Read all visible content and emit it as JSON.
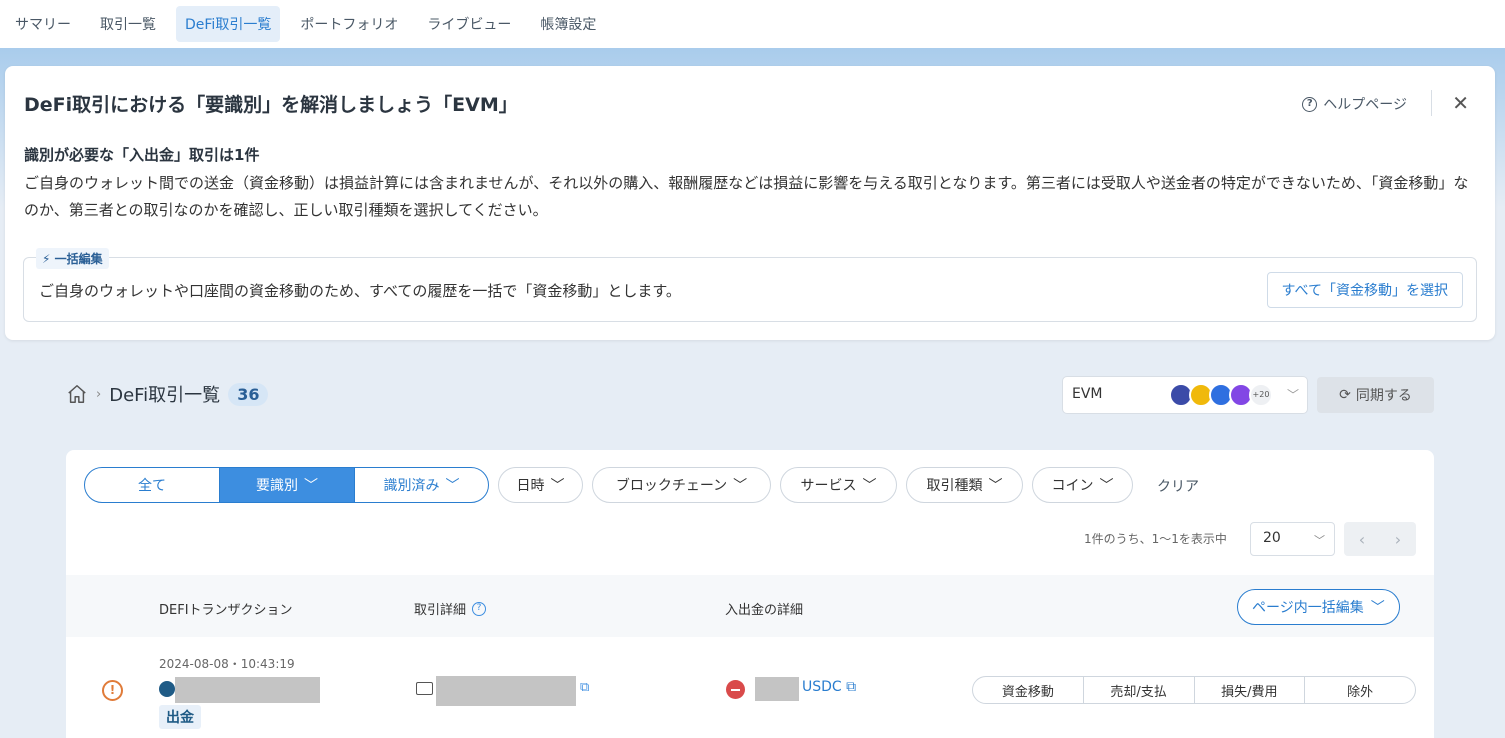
{
  "nav": {
    "tabs": [
      {
        "label": "サマリー"
      },
      {
        "label": "取引一覧"
      },
      {
        "label": "DeFi取引一覧",
        "active": true
      },
      {
        "label": "ポートフォリオ"
      },
      {
        "label": "ライブビュー"
      },
      {
        "label": "帳簿設定"
      }
    ]
  },
  "banner": {
    "title": "DeFi取引における「要識別」を解消しましょう「EVM」",
    "help_label": "ヘルプページ",
    "subtitle": "識別が必要な「入出金」取引は1件",
    "description": "ご自身のウォレット間での送金（資金移動）は損益計算には含まれませんが、それ以外の購入、報酬履歴などは損益に影響を与える取引となります。第三者には受取人や送金者の特定ができないため、「資金移動」なのか、第三者との取引なのかを確認し、正しい取引種類を選択してください。",
    "bulk_tag": "一括編集",
    "bulk_text": "ご自身のウォレットや口座間の資金移動のため、すべての履歴を一括で「資金移動」とします。",
    "bulk_button": "すべて「資金移動」を選択"
  },
  "breadcrumb": {
    "title": "DeFi取引一覧",
    "count": "36"
  },
  "chain_select": {
    "label": "EVM",
    "more": "+20"
  },
  "sync_button": "同期する",
  "filters": {
    "segments": [
      {
        "label": "全て"
      },
      {
        "label": "要識別",
        "active": true
      },
      {
        "label": "識別済み"
      }
    ],
    "dropdowns": [
      "日時",
      "ブロックチェーン",
      "サービス",
      "取引種類",
      "コイン"
    ],
    "clear": "クリア"
  },
  "pagination": {
    "info": "1件のうち、1〜1を表示中",
    "per_page": "20"
  },
  "table": {
    "headers": {
      "tx": "DEFIトランザクション",
      "detail": "取引詳細",
      "io": "入出金の詳細"
    },
    "bulk_page_button": "ページ内一括編集",
    "rows": [
      {
        "timestamp": "2024-08-08・10:43:19",
        "direction": "出金",
        "coin": "USDC",
        "type_options": [
          "資金移動",
          "売却/支払",
          "損失/費用",
          "除外"
        ]
      }
    ]
  },
  "colors": {
    "accent": "#2a7dcf",
    "warning": "#e07b39",
    "outflow": "#d94a4a"
  }
}
